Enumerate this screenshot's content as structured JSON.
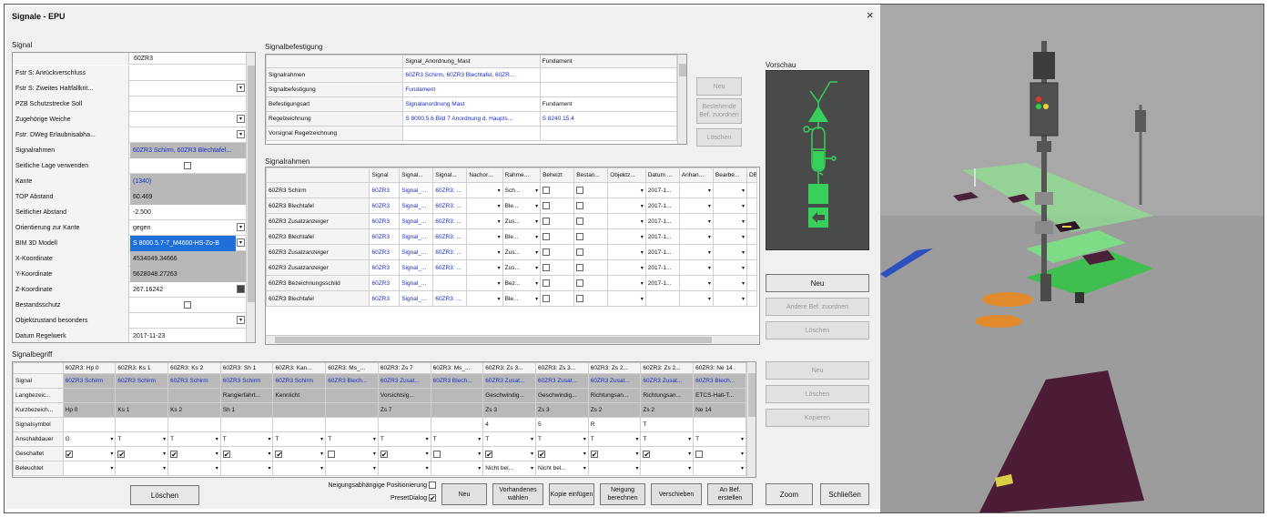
{
  "window": {
    "title": "Signale - EPU",
    "close": "×"
  },
  "signal": {
    "label": "Signal",
    "header_value": "60ZR3",
    "rows": [
      {
        "k": "Fstr S: Anrückverschluss",
        "v": "",
        "dd": false
      },
      {
        "k": "Fstr S: Zweites Haltfallkrit...",
        "v": "",
        "dd": true
      },
      {
        "k": "PZB Schutzstrecke Soll",
        "v": "",
        "dd": false
      },
      {
        "k": "Zugehörige Weiche",
        "v": "",
        "dd": true
      },
      {
        "k": "Fstr: DWeg Erlaubnisabha...",
        "v": "",
        "dd": true
      },
      {
        "k": "Signalrahmen",
        "v": "60ZR3 Schirm, 60ZR3 Blechtafel...",
        "dd": false,
        "gray": true,
        "blue": true
      },
      {
        "k": "Seitliche Lage verwenden",
        "v": "",
        "chk": true
      },
      {
        "k": "Kante",
        "v": "(1340)",
        "gray": true,
        "blue": true
      },
      {
        "k": "TOP Abstand",
        "v": "60.469",
        "gray": true
      },
      {
        "k": "Seitlicher Abstand",
        "v": "-2.500"
      },
      {
        "k": "Orientierung zur Kante",
        "v": "gegen",
        "dd": true
      },
      {
        "k": "BIM 3D Modell",
        "v": "S 8000.5.7-7_M4600-HS-Zo-B",
        "dd": true,
        "sel": true
      },
      {
        "k": "X-Koordinate",
        "v": "4534049.34666",
        "gray": true
      },
      {
        "k": "Y-Koordinate",
        "v": "5628048.27263",
        "gray": true
      },
      {
        "k": "Z-Koordinate",
        "v": "267.16242",
        "calc": true
      },
      {
        "k": "Bestandsschutz",
        "v": "",
        "chk": true
      },
      {
        "k": "Objektzustand besonders",
        "v": "",
        "dd": true
      },
      {
        "k": "Datum Regelwerk",
        "v": "2017-11-23"
      }
    ]
  },
  "befestigung": {
    "label": "Signalbefestigung",
    "headers": [
      "",
      "Signal_Anordnung_Mast",
      "Fundament"
    ],
    "rows": [
      [
        "Signalrahmen",
        "60ZR3 Schirm, 60ZR3 Blechtafel, 60ZR...",
        ""
      ],
      [
        "Signalbefestigung",
        "Fundament",
        ""
      ],
      [
        "Befestigungsart",
        "Signalanordnung Mast",
        "Fundament"
      ],
      [
        "Regelzeichnung",
        "S 8000.5.6 Bild 7 Anordnung d. Haupts...",
        "S 8240.15.4"
      ],
      [
        "Vorsignal Regelzeichnung",
        "",
        ""
      ]
    ],
    "buttons": [
      "Neu",
      "Bestehende Bef. zuordnen",
      "Löschen"
    ]
  },
  "rahmen": {
    "label": "Signalrahmen",
    "headers": [
      "",
      "Signal",
      "Signal...",
      "Signal...",
      "Nachor...",
      "Rahme...",
      "Beheizt",
      "Bestan...",
      "Objektz...",
      "Datum ...",
      "Anhan...",
      "Bearbe...",
      "DB"
    ],
    "rows": [
      [
        "60ZR3 Schirm",
        "60ZR3",
        "Signal_...",
        "60ZR3: ...",
        "",
        "Sch...",
        "",
        "",
        "",
        "2017-1...",
        "",
        ""
      ],
      [
        "60ZR3 Blechtafel",
        "60ZR3",
        "Signal_...",
        "60ZR3: ...",
        "",
        "Ble...",
        "",
        "",
        "",
        "2017-1...",
        "",
        ""
      ],
      [
        "60ZR3 Zusatzanzeiger",
        "60ZR3",
        "Signal_...",
        "60ZR3: ...",
        "",
        "Zus...",
        "",
        "",
        "",
        "2017-1...",
        "",
        ""
      ],
      [
        "60ZR3 Blechtafel",
        "60ZR3",
        "Signal_...",
        "60ZR3: ...",
        "",
        "Ble...",
        "",
        "",
        "",
        "2017-1...",
        "",
        ""
      ],
      [
        "60ZR3 Zusatzanzeiger",
        "60ZR3",
        "Signal_...",
        "60ZR3: ...",
        "",
        "Zus...",
        "",
        "",
        "",
        "2017-1...",
        "",
        ""
      ],
      [
        "60ZR3 Zusatzanzeiger",
        "60ZR3",
        "Signal_...",
        "60ZR3: ...",
        "",
        "Zus...",
        "",
        "",
        "",
        "2017-1...",
        "",
        ""
      ],
      [
        "60ZR3 Bezeichnungsschild",
        "60ZR3",
        "Signal_...",
        "",
        "",
        "Bez...",
        "",
        "",
        "",
        "2017-1...",
        "",
        ""
      ],
      [
        "60ZR3 Blechtafel",
        "60ZR3",
        "Signal_...",
        "60ZR3: ...",
        "",
        "Ble...",
        "",
        "",
        "",
        "",
        "",
        ""
      ]
    ]
  },
  "vorschau": {
    "label": "Vorschau",
    "buttons": [
      "Neu",
      "Andere Bef. zuordnen",
      "Löschen"
    ]
  },
  "begriff": {
    "label": "Signalbegriff",
    "headers": [
      "60ZR3: Hp 0",
      "60ZR3: Ks 1",
      "60ZR3: Ks 2",
      "60ZR3: Sh 1",
      "60ZR3: Kan...",
      "60ZR3: Ms_...",
      "60ZR3: Zs 7",
      "60ZR3: Ms_...",
      "60ZR3: Zs 3...",
      "60ZR3: Zs 3...",
      "60ZR3: Zs 2...",
      "60ZR3: Zs 2...",
      "60ZR3: Ne 14"
    ],
    "rows": [
      {
        "k": "Signal",
        "cells": [
          "60ZR3 Schirm",
          "60ZR3 Schirm",
          "60ZR3 Schirm",
          "60ZR3 Schirm",
          "60ZR3 Schirm",
          "60ZR3 Blech...",
          "60ZR3 Zusat...",
          "60ZR3 Blech...",
          "60ZR3 Zusat...",
          "60ZR3 Zusat...",
          "60ZR3 Zusat...",
          "60ZR3 Zusat...",
          "60ZR3 Blech..."
        ],
        "blue": true
      },
      {
        "k": "Langbezeic...",
        "cells": [
          "",
          "",
          "",
          "Rangierfahrt...",
          "Kennlicht",
          "",
          "Vorsichtsig...",
          "",
          "Geschwindig...",
          "Geschwindig...",
          "Richtungsan...",
          "Richtungsan...",
          "ETCS-Halt-T..."
        ]
      },
      {
        "k": "Kurzbezeich...",
        "cells": [
          "Hp 0",
          "Ks 1",
          "Ks 2",
          "Sh 1",
          "",
          "",
          "Zs 7",
          "",
          "Zs 3",
          "Zs 3",
          "Zs 2",
          "Zs 2",
          "Ne 14"
        ]
      },
      {
        "k": "Signalsymbol",
        "cells": [
          "",
          "",
          "",
          "",
          "",
          "",
          "",
          "",
          "4",
          "5",
          "R",
          "T",
          ""
        ]
      },
      {
        "k": "Anschaltdauer",
        "cells": [
          "G",
          "T",
          "T",
          "T",
          "T",
          "T",
          "T",
          "T",
          "T",
          "T",
          "T",
          "T",
          "T"
        ]
      },
      {
        "k": "Geschaltet",
        "cells": [
          "✔",
          "✔",
          "✔",
          "✔",
          "✔",
          "",
          "✔",
          "",
          "✔",
          "✔",
          "✔",
          "✔",
          ""
        ]
      },
      {
        "k": "Beleuchtet",
        "cells": [
          "",
          "",
          "",
          "",
          "",
          "",
          "",
          "",
          "Nicht bel...",
          "Nicht bel...",
          "",
          "",
          ""
        ]
      }
    ],
    "buttons": [
      "Neu",
      "Löschen",
      "Kopieren"
    ]
  },
  "bottom": {
    "loeschen": "Löschen",
    "neigung_pos": "Neigungsabhängige Positionierung",
    "preset": "PresetDialog",
    "neu": "Neu",
    "vorhandenes": "Vorhandenes wählen",
    "kopie": "Kopie einfügen",
    "neigung": "Neigung berechnen",
    "verschieben": "Verschieben",
    "anbef": "An Bef. erstellen",
    "zoom": "Zoom",
    "schliessen": "Schließen"
  }
}
